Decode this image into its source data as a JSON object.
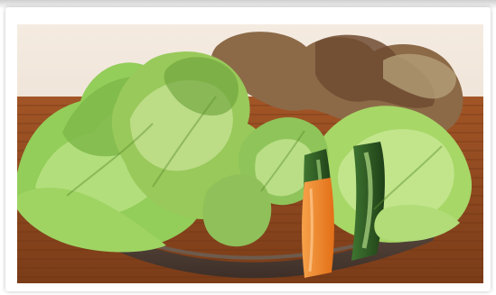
{
  "photo": {
    "subject": "salad-bowl-photo",
    "colors": {
      "background": "#f0e6dc",
      "mat": "#8f4a20",
      "mat_stripe": "#6d3414",
      "bowl": "#4d3d33",
      "lettuce_light": "#a9d86f",
      "lettuce_mid": "#7fbe4c",
      "lettuce_dark": "#5b8f2f",
      "red_leaf": "#8a5a3c",
      "cucumber": "#2f5b24",
      "cucumber_light": "#9dcc76",
      "carrot": "#f08a2a"
    }
  }
}
